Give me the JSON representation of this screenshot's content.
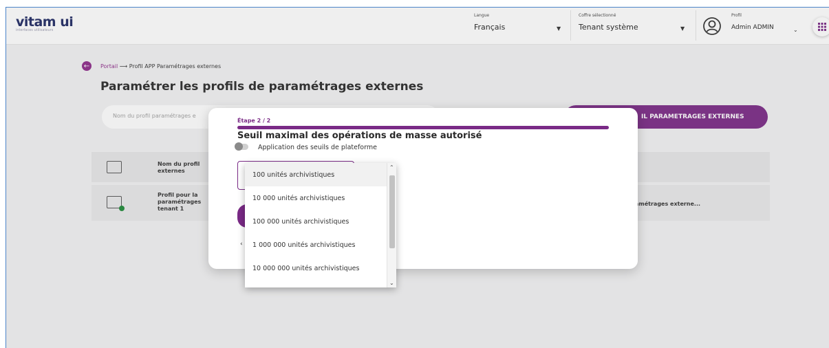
{
  "header": {
    "logo_text": "vitam ui",
    "logo_subtext": "interfaces utilisateurs",
    "langue_label": "Langue",
    "langue_value": "Français",
    "coffre_label": "Coffre sélectionné",
    "coffre_value": "Tenant système",
    "profil_label": "Profil",
    "profil_value": "Admin ADMIN"
  },
  "breadcrumb": {
    "portal": "Portail",
    "arrow": "⟶",
    "current": "Profil APP Paramétrages externes"
  },
  "page_title": "Paramétrer les profils de paramétrages externes",
  "search_placeholder": "Nom du profil paramétrages e",
  "add_button_label": "IL PARAMETRAGES EXTERNES",
  "table": {
    "header_cell": "Nom du profil externes",
    "row_cell": "Profil pour la paramétrages tenant 1",
    "row_right": "amétrages externe..."
  },
  "modal": {
    "step": "Étape 2 / 2",
    "title": "Seuil maximal des opérations de masse autorisé",
    "toggle_label": "Application des seuils de plateforme",
    "back_chevron": "‹"
  },
  "dropdown": {
    "options": [
      "100 unités archivistiques",
      "10 000 unités archivistiques",
      "100 000 unités archivistiques",
      "1 000 000 unités archivistiques",
      "10 000 000 unités archivistiques"
    ],
    "selected": "100 unités archivistiques"
  },
  "colors": {
    "brand_purple": "#7a2a86",
    "navy": "#1f2a63",
    "success_green": "#1f8a3a"
  }
}
